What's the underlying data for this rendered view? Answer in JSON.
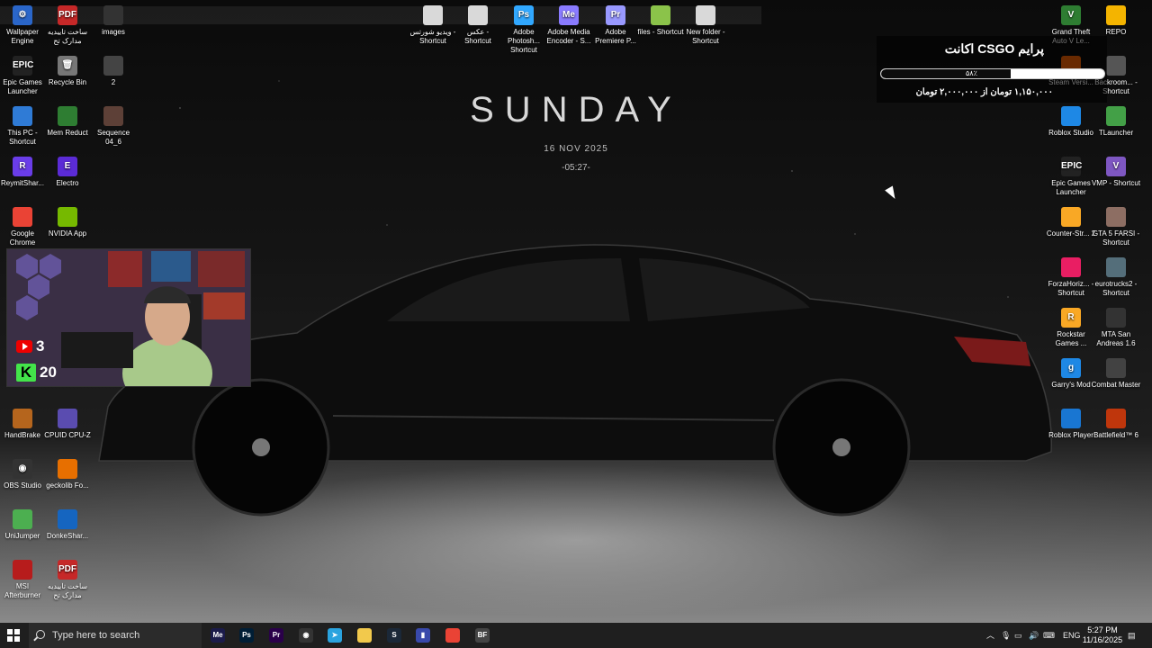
{
  "wallpaper": {
    "title": "SUNDAY",
    "date": "16 NOV 2025",
    "time": "-05:27-"
  },
  "left_icons": [
    {
      "label": "Wallpaper Engine",
      "icon": "wallpaper-engine-icon",
      "color": "#2a66c9",
      "glyph": "⚙"
    },
    {
      "label": "ساخت تاییدیه مدارک تح",
      "icon": "pdf-file-icon",
      "color": "#c62828",
      "glyph": "PDF"
    },
    {
      "label": "images",
      "icon": "folder-icon",
      "color": "#333333",
      "glyph": ""
    },
    {
      "label": "Epic Games Launcher",
      "icon": "epic-games-icon",
      "color": "#222222",
      "glyph": "EPIC"
    },
    {
      "label": "Recycle Bin",
      "icon": "recycle-bin-icon",
      "color": "#777777",
      "glyph": "🗑"
    },
    {
      "label": "2",
      "icon": "image-file-icon",
      "color": "#444444",
      "glyph": ""
    },
    {
      "label": "This PC - Shortcut",
      "icon": "this-pc-icon",
      "color": "#2f7bd6",
      "glyph": ""
    },
    {
      "label": "Mem Reduct",
      "icon": "mem-reduct-icon",
      "color": "#2e7d32",
      "glyph": ""
    },
    {
      "label": "Sequence 04_6",
      "icon": "video-file-icon",
      "color": "#5d4037",
      "glyph": ""
    },
    {
      "label": "ReymitShar...",
      "icon": "reymit-icon",
      "color": "#6a3de8",
      "glyph": "R"
    },
    {
      "label": "Electro",
      "icon": "electro-icon",
      "color": "#5b2bd6",
      "glyph": "E"
    },
    {
      "label": "Google Chrome",
      "icon": "chrome-icon",
      "color": "#ea4335",
      "glyph": ""
    },
    {
      "label": "NVIDIA App",
      "icon": "nvidia-icon",
      "color": "#76b900",
      "glyph": ""
    },
    {
      "label": "HandBrake",
      "icon": "handbrake-icon",
      "color": "#b5651d",
      "glyph": ""
    },
    {
      "label": "CPUID CPU-Z",
      "icon": "cpuz-icon",
      "color": "#5a4cb0",
      "glyph": ""
    },
    {
      "label": "OBS Studio",
      "icon": "obs-icon",
      "color": "#333333",
      "glyph": "◉"
    },
    {
      "label": "geckolib Fo...",
      "icon": "java-icon",
      "color": "#e76f00",
      "glyph": ""
    },
    {
      "label": "UniJumper",
      "icon": "unijumper-icon",
      "color": "#4caf50",
      "glyph": ""
    },
    {
      "label": "DonkeShar...",
      "icon": "donkeshar-icon",
      "color": "#1565c0",
      "glyph": ""
    },
    {
      "label": "MSI Afterburner",
      "icon": "msi-afterburner-icon",
      "color": "#b71c1c",
      "glyph": ""
    },
    {
      "label": "ساخت تاییدیه مدارک تح",
      "icon": "pdf-file-icon",
      "color": "#c62828",
      "glyph": "PDF"
    }
  ],
  "top_icons": [
    {
      "label": "ویدیو شورتس - Shortcut",
      "icon": "folder-shortcut-icon",
      "color": "#d9d9d9",
      "glyph": ""
    },
    {
      "label": "عکس - Shortcut",
      "icon": "folder-shortcut-icon",
      "color": "#d9d9d9",
      "glyph": ""
    },
    {
      "label": "Adobe Photosh... Shortcut",
      "icon": "photoshop-icon",
      "color": "#31a8ff",
      "glyph": "Ps"
    },
    {
      "label": "Adobe Media Encoder - S...",
      "icon": "media-encoder-icon",
      "color": "#8a7bff",
      "glyph": "Me"
    },
    {
      "label": "Adobe Premiere P...",
      "icon": "premiere-icon",
      "color": "#9999ff",
      "glyph": "Pr"
    },
    {
      "label": "files - Shortcut",
      "icon": "folder-shortcut-icon",
      "color": "#8bc34a",
      "glyph": ""
    },
    {
      "label": "New folder - Shortcut",
      "icon": "folder-shortcut-icon",
      "color": "#d9d9d9",
      "glyph": ""
    }
  ],
  "right_icons": [
    {
      "label": "Grand Theft Auto V Le...",
      "icon": "gta-v-icon",
      "color": "#2e7d32",
      "glyph": "V"
    },
    {
      "label": "REPO",
      "icon": "repo-icon",
      "color": "#f4b400",
      "glyph": ""
    },
    {
      "label": "Steam Versi...",
      "icon": "steam-icon",
      "color": "#e85d04",
      "glyph": ""
    },
    {
      "label": "Backroom... - Shortcut",
      "icon": "backrooms-icon",
      "color": "#555555",
      "glyph": ""
    },
    {
      "label": "Roblox Studio",
      "icon": "roblox-studio-icon",
      "color": "#1e88e5",
      "glyph": ""
    },
    {
      "label": "TLauncher",
      "icon": "tlauncher-icon",
      "color": "#43a047",
      "glyph": ""
    },
    {
      "label": "Epic Games Launcher",
      "icon": "epic-games-icon",
      "color": "#222222",
      "glyph": "EPIC"
    },
    {
      "label": "VMP - Shortcut",
      "icon": "vmp-icon",
      "color": "#7e57c2",
      "glyph": "V"
    },
    {
      "label": "Counter-Str... 2",
      "icon": "cs2-icon",
      "color": "#f9a825",
      "glyph": ""
    },
    {
      "label": "GTA 5 FARSI - Shortcut",
      "icon": "gta-farsi-icon",
      "color": "#8d6e63",
      "glyph": ""
    },
    {
      "label": "ForzaHoriz... - Shortcut",
      "icon": "forza-icon",
      "color": "#e91e63",
      "glyph": ""
    },
    {
      "label": "eurotrucks2 - Shortcut",
      "icon": "eurotrucks-icon",
      "color": "#546e7a",
      "glyph": ""
    },
    {
      "label": "Rockstar Games ...",
      "icon": "rockstar-icon",
      "color": "#f9a825",
      "glyph": "R"
    },
    {
      "label": "MTA San Andreas 1.6",
      "icon": "mta-icon",
      "color": "#333333",
      "glyph": ""
    },
    {
      "label": "Garry's Mod",
      "icon": "garrys-mod-icon",
      "color": "#1e88e5",
      "glyph": "g"
    },
    {
      "label": "Combat Master",
      "icon": "combat-master-icon",
      "color": "#424242",
      "glyph": ""
    },
    {
      "label": "Roblox Player",
      "icon": "roblox-icon",
      "color": "#1976d2",
      "glyph": ""
    },
    {
      "label": "Battlefield™ 6",
      "icon": "battlefield-icon",
      "color": "#bf360c",
      "glyph": ""
    }
  ],
  "webcam_overlay": {
    "youtube_count": "3",
    "kick_count": "20"
  },
  "donation_goal": {
    "title": "پرایم CSGO اکانت",
    "percent_label": "۵۸٪",
    "progress": 0.58,
    "amount_text": "۱,۱۵۰,۰۰۰ تومان از ۲,۰۰۰,۰۰۰ تومان"
  },
  "taskbar": {
    "search_placeholder": "Type here to search",
    "apps": [
      {
        "icon": "media-encoder-icon",
        "glyph": "Me",
        "color": "#1b1b4a"
      },
      {
        "icon": "photoshop-icon",
        "glyph": "Ps",
        "color": "#001e36"
      },
      {
        "icon": "premiere-icon",
        "glyph": "Pr",
        "color": "#2a004a"
      },
      {
        "icon": "obs-icon",
        "glyph": "◉",
        "color": "#333333"
      },
      {
        "icon": "telegram-icon",
        "glyph": "➤",
        "color": "#2aa3df"
      },
      {
        "icon": "file-explorer-icon",
        "glyph": "",
        "color": "#f2c94c"
      },
      {
        "icon": "steam-icon",
        "glyph": "S",
        "color": "#1b2838"
      },
      {
        "icon": "analytics-icon",
        "glyph": "▮",
        "color": "#3949ab"
      },
      {
        "icon": "chrome-icon",
        "glyph": "",
        "color": "#ea4335"
      },
      {
        "icon": "battlefield-icon",
        "glyph": "BF",
        "color": "#444444"
      }
    ],
    "language": "ENG",
    "time": "5:27 PM",
    "date": "11/16/2025"
  }
}
